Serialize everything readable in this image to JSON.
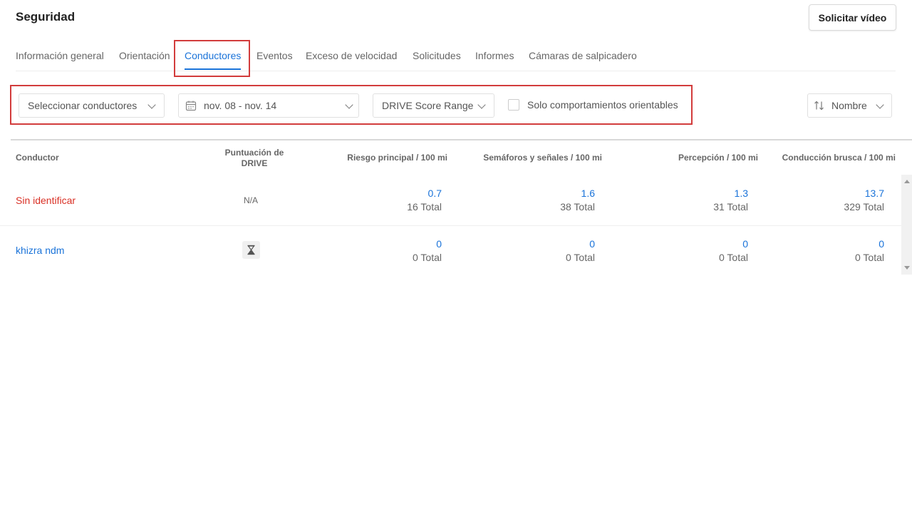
{
  "header": {
    "title": "Seguridad",
    "request_video_label": "Solicitar vídeo"
  },
  "tabs": [
    {
      "label": "Información general",
      "active": false
    },
    {
      "label": "Orientación",
      "active": false
    },
    {
      "label": "Conductores",
      "active": true
    },
    {
      "label": "Eventos",
      "active": false
    },
    {
      "label": "Exceso de velocidad",
      "active": false
    },
    {
      "label": "Solicitudes",
      "active": false
    },
    {
      "label": "Informes",
      "active": false
    },
    {
      "label": "Cámaras de salpicadero",
      "active": false
    }
  ],
  "filters": {
    "driver_select": "Seleccionar conductores",
    "date_range": "nov. 08 - nov. 14",
    "score_range": "DRIVE Score Range",
    "coachable_only_label": "Solo comportamientos orientables",
    "coachable_only_checked": false,
    "sort_label": "Nombre"
  },
  "table": {
    "headers": {
      "driver": "Conductor",
      "score_line1": "Puntuación de",
      "score_line2": "DRIVE",
      "top_risk": "Riesgo principal / 100 mi",
      "traffic_signs": "Semáforos y señales / 100 mi",
      "perception": "Percepción / 100 mi",
      "harsh_driving": "Conducción brusca / 100 mi"
    },
    "rows": [
      {
        "driver": "Sin identificar",
        "driver_color": "#d93025",
        "score": "N/A",
        "top_risk": {
          "rate": "0.7",
          "total": "16 Total"
        },
        "traffic_signs": {
          "rate": "1.6",
          "total": "38 Total"
        },
        "perception": {
          "rate": "1.3",
          "total": "31 Total"
        },
        "harsh_driving": {
          "rate": "13.7",
          "total": "329 Total"
        }
      },
      {
        "driver": "khizra ndm",
        "driver_color": "#1a73d9",
        "score_icon": "hourglass-icon",
        "top_risk": {
          "rate": "0",
          "total": "0 Total"
        },
        "traffic_signs": {
          "rate": "0",
          "total": "0 Total"
        },
        "perception": {
          "rate": "0",
          "total": "0 Total"
        },
        "harsh_driving": {
          "rate": "0",
          "total": "0 Total"
        }
      }
    ]
  },
  "colors": {
    "accent": "#1a73d9",
    "highlight": "#d23c3c",
    "unidentified": "#d93025"
  }
}
